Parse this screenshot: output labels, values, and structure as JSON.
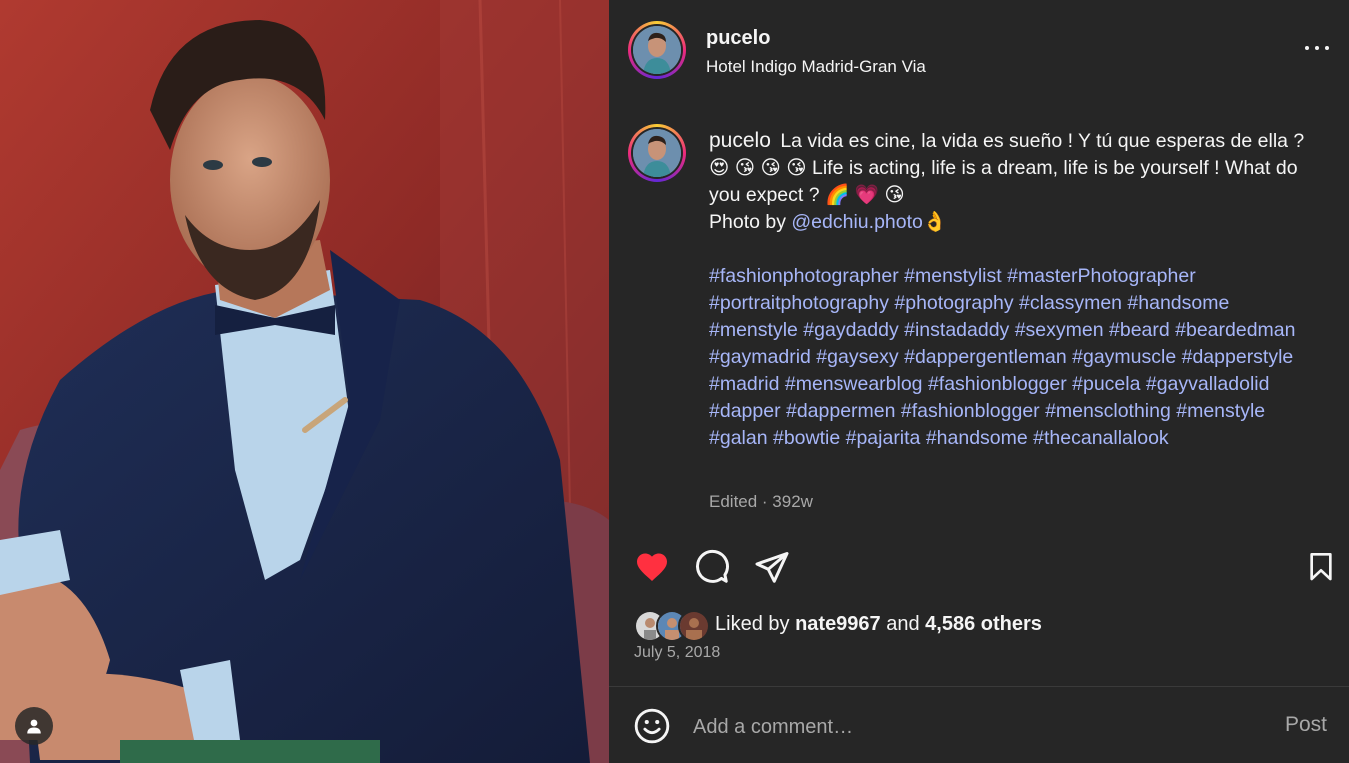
{
  "post": {
    "username": "pucelo",
    "location": "Hotel Indigo Madrid-Gran Via",
    "more_icon": "more-horizontal-icon"
  },
  "caption": {
    "username": "pucelo",
    "text_1": "La vida es cine, la vida es sueño ! Y tú que esperas de ella ? 😍 😘 😘 😘 Life is acting, life is a dream, life is be yourself ! What do you expect ? 🌈 💗 😘",
    "photo_by": "Photo by ",
    "mention": "@edchiu.photo",
    "mention_emoji": "👌",
    "hashtags": "#fashionphotographer #menstylist #masterPhotographer #portraitphotography #photography #classymen #handsome #menstyle #gaydaddy #instadaddy #sexymen #beard #beardedman #gaymadrid #gaysexy #dappergentleman #gaymuscle #dapperstyle #madrid #menswearblog #fashionblogger #pucela #gayvalladolid #dapper #dappermen #fashionblogger #mensclothing #menstyle #galan #bowtie #pajarita #handsome #thecanallalook",
    "edited": "Edited · 392w"
  },
  "actions": {
    "like_icon": "heart-filled-icon",
    "comment_icon": "comment-icon",
    "share_icon": "share-icon",
    "save_icon": "bookmark-icon",
    "like_color": "#ff3040"
  },
  "likes": {
    "prefix": "Liked by ",
    "user": "nate9967",
    "middle": " and ",
    "others": "4,586 others"
  },
  "date": "July 5, 2018",
  "comment": {
    "placeholder": "Add a comment…",
    "post_label": "Post",
    "emoji_icon": "emoji-icon"
  },
  "photo": {
    "tag_icon": "user-tag-icon"
  }
}
